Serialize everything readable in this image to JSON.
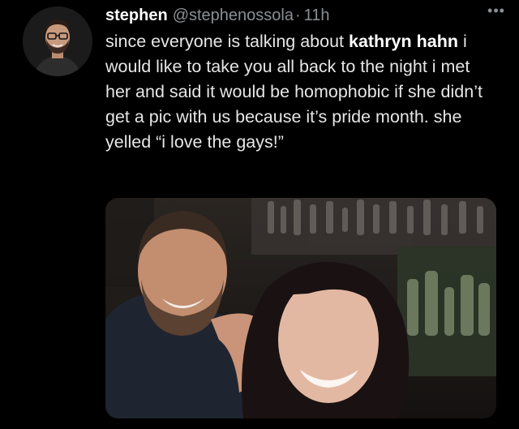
{
  "tweet": {
    "display_name": "stephen",
    "handle": "@stephenossola",
    "separator": "·",
    "time": "11h",
    "more_icon": "more-horizontal-icon",
    "text_part1": "since everyone is talking about ",
    "text_bold": "kathryn hahn",
    "text_part2": " i would like to take you all back to the night i met her and said it would be homophobic if she didn’t get a pic with us because it’s pride month. she yelled “i love the gays!”"
  },
  "colors": {
    "background": "#000000",
    "text": "#e6e6e6",
    "secondary": "#8a8f94"
  }
}
